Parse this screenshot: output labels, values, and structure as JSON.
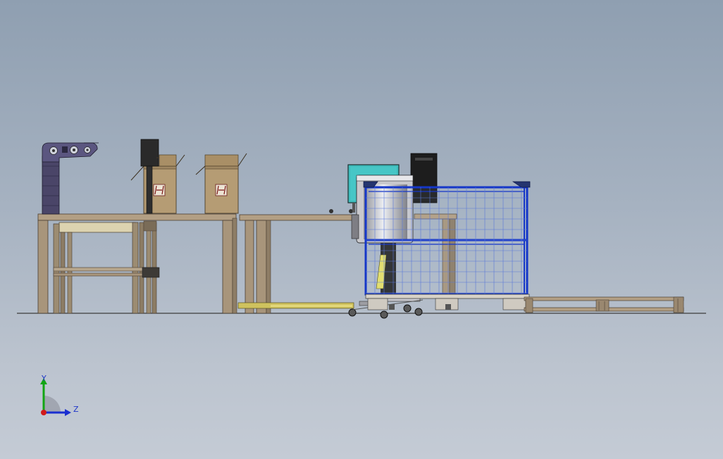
{
  "triad": {
    "y_label": "Y",
    "z_label": "Z",
    "y_color": "#12a512",
    "z_color": "#1a2fd0",
    "x_color": "#d01a1a",
    "label_color": "#1f36c8"
  },
  "scene": {
    "floor_color": "#3c3c3c",
    "table_color": "#b39f84",
    "cage_color": "#1436c8",
    "monitor_color": "#3fbcbc",
    "box_color": "#b59c74"
  }
}
